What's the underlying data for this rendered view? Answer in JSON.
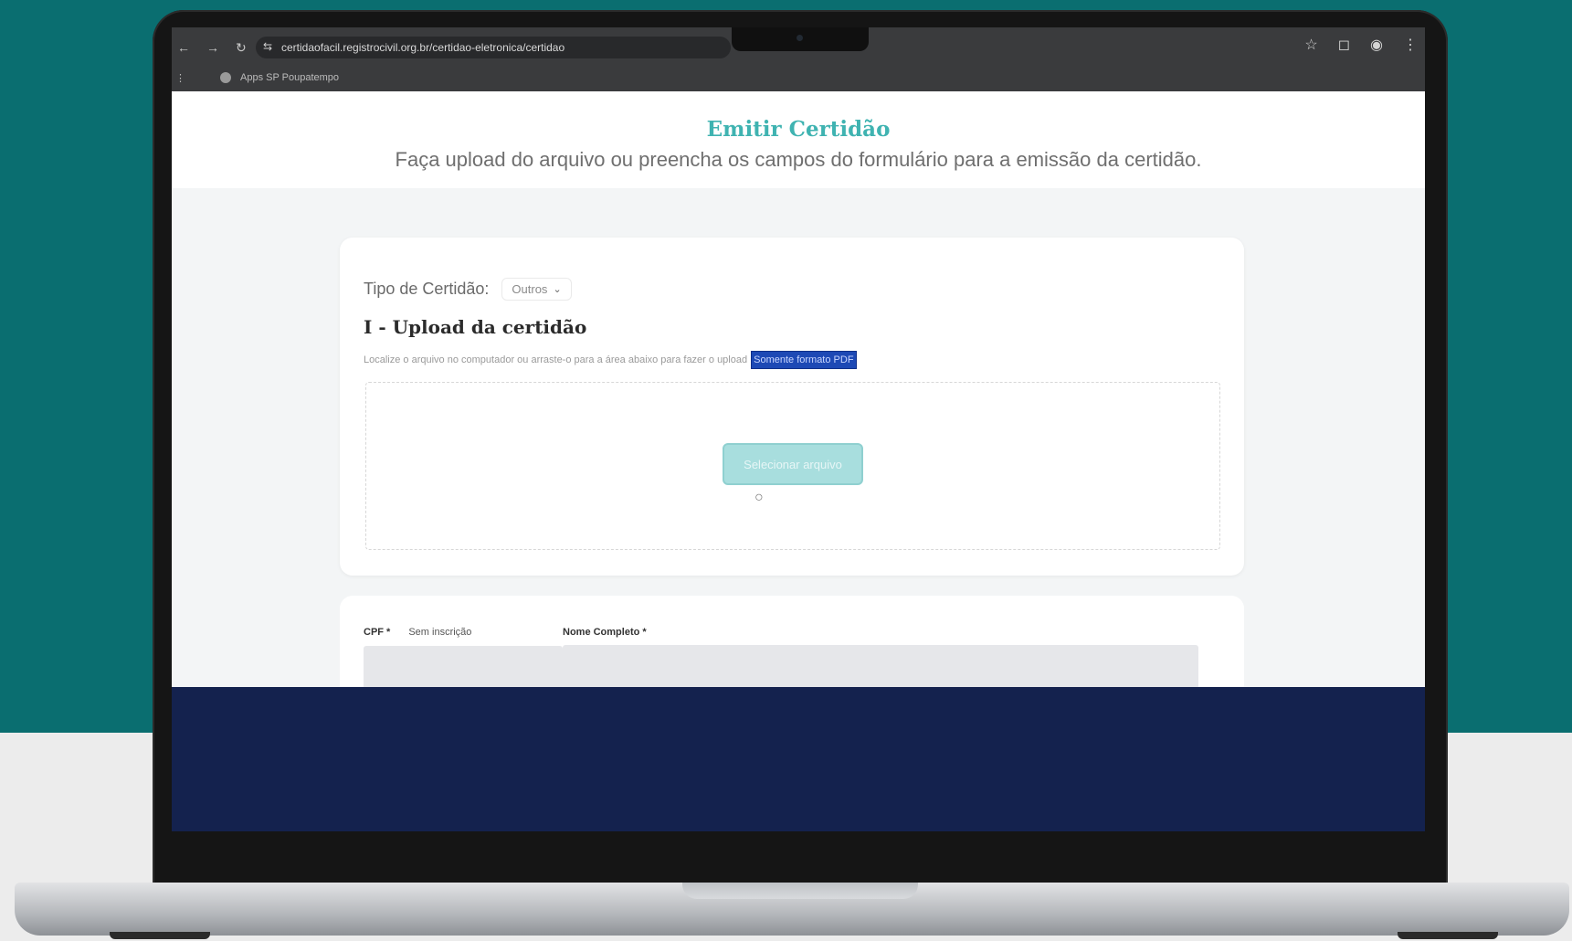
{
  "browser": {
    "url": "certidaofacil.registrocivil.org.br/certidao-eletronica/certidao",
    "bookmark_label": "Apps SP Poupatempo",
    "icons": [
      "back-arrow-icon",
      "forward-arrow-icon",
      "reload-icon",
      "tune-icon",
      "star-icon",
      "extensions-icon",
      "profile-icon",
      "menu-icon"
    ]
  },
  "page": {
    "title": "Emitir Certidão",
    "subtitle": "Faça upload do arquivo ou preencha os campos do formulário para a emissão da certidão."
  },
  "upload_card": {
    "tipo_label": "Tipo de Certidão:",
    "tipo_value": "Outros",
    "section_title": "I - Upload da certidão",
    "section_desc": "Localize o arquivo no computador ou arraste-o para a área abaixo para fazer o upload",
    "pdf_note": "Somente formato PDF",
    "upload_button_label": "Selecionar arquivo"
  },
  "form_card": {
    "cpf_label": "CPF *",
    "cpf_sub": "Sem inscrição",
    "nome_label": "Nome Completo *"
  },
  "colors": {
    "teal_background": "#0a6e70",
    "title_teal": "#3fb3b1",
    "footer_navy": "#14224e",
    "highlight_blue": "#1d49b5"
  }
}
